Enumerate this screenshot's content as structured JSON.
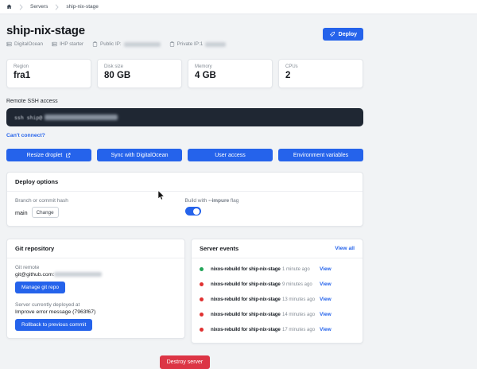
{
  "colors": {
    "primary": "#2563eb",
    "danger": "#dc3545",
    "terminal": "#1f2733",
    "green": "#23a559",
    "red": "#e03131"
  },
  "breadcrumb": {
    "items": [
      "Servers",
      "ship-nix-stage"
    ]
  },
  "header": {
    "title": "ship-nix-stage",
    "deploy_label": "Deploy",
    "badges": [
      {
        "icon": "server-icon",
        "label": "DigitalOcean",
        "redacted": false
      },
      {
        "icon": "server-icon",
        "label": "IHP starter",
        "redacted": false
      },
      {
        "icon": "clipboard-icon",
        "label": "Public IP:",
        "redacted": true
      },
      {
        "icon": "clipboard-icon",
        "label": "Private IP:1",
        "redacted": true
      }
    ]
  },
  "stats": [
    {
      "label": "Region",
      "value": "fra1"
    },
    {
      "label": "Disk size",
      "value": "80 GB"
    },
    {
      "label": "Memory",
      "value": "4 GB"
    },
    {
      "label": "CPUs",
      "value": "2"
    }
  ],
  "ssh": {
    "label": "Remote SSH access",
    "command_prefix": "ssh ship@",
    "help_link": "Can't connect?"
  },
  "actions": [
    "Resize droplet",
    "Sync with DigitalOcean",
    "User access",
    "Environment variables"
  ],
  "deploy_options": {
    "title": "Deploy options",
    "branch_label": "Branch or commit hash",
    "branch_value": "main",
    "change_label": "Change",
    "impure_pre": "Build with ",
    "impure_flag": "--impure",
    "impure_post": " flag",
    "impure_toggle_on": true
  },
  "git": {
    "title": "Git repository",
    "remote_label": "Git remote",
    "remote_value": "git@github.com:",
    "manage_label": "Manage git repo",
    "deployed_label": "Server currently deployed at",
    "deployed_value": "Improve error message (7963f67)",
    "rollback_label": "Rollback to previous commit"
  },
  "events": {
    "title": "Server events",
    "view_all": "View all",
    "view_label": "View",
    "rows": [
      {
        "status": "green",
        "name": "nixos-rebuild for ship-nix-stage",
        "time": "1 minute ago"
      },
      {
        "status": "red",
        "name": "nixos-rebuild for ship-nix-stage",
        "time": "9 minutes ago"
      },
      {
        "status": "red",
        "name": "nixos-rebuild for ship-nix-stage",
        "time": "13 minutes ago"
      },
      {
        "status": "red",
        "name": "nixos-rebuild for ship-nix-stage",
        "time": "14 minutes ago"
      },
      {
        "status": "red",
        "name": "nixos-rebuild for ship-nix-stage",
        "time": "17 minutes ago"
      }
    ]
  },
  "danger": {
    "destroy_label": "Destroy server"
  }
}
